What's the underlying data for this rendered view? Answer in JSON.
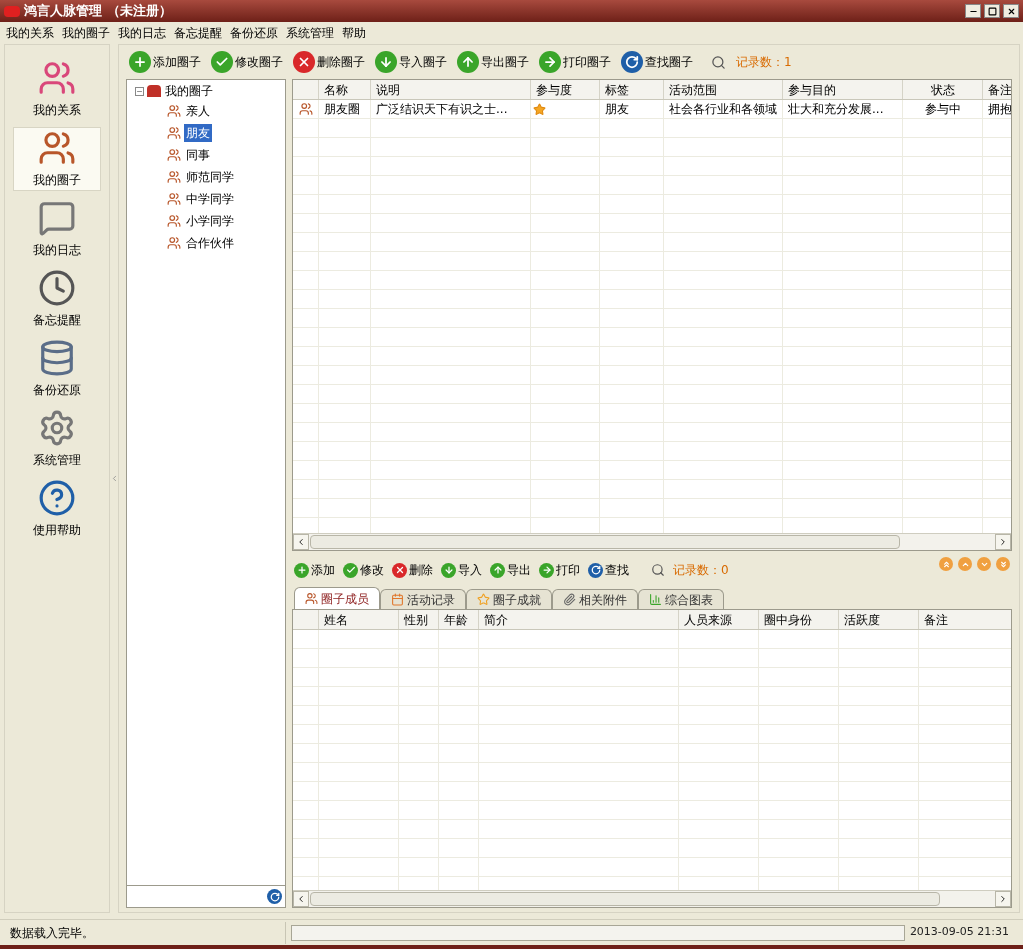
{
  "window": {
    "title": "鸿言人脉管理 （未注册）"
  },
  "menu": [
    "我的关系",
    "我的圈子",
    "我的日志",
    "备忘提醒",
    "备份还原",
    "系统管理",
    "帮助"
  ],
  "nav": [
    {
      "label": "我的关系",
      "kind": "people",
      "selected": false
    },
    {
      "label": "我的圈子",
      "kind": "group",
      "selected": true
    },
    {
      "label": "我的日志",
      "kind": "note",
      "selected": false
    },
    {
      "label": "备忘提醒",
      "kind": "clock",
      "selected": false
    },
    {
      "label": "备份还原",
      "kind": "database",
      "selected": false
    },
    {
      "label": "系统管理",
      "kind": "settings",
      "selected": false
    },
    {
      "label": "使用帮助",
      "kind": "help",
      "selected": false
    }
  ],
  "toolbar": {
    "buttons": [
      {
        "label": "添加圈子",
        "kind": "add"
      },
      {
        "label": "修改圈子",
        "kind": "edit"
      },
      {
        "label": "删除圈子",
        "kind": "delete"
      },
      {
        "label": "导入圈子",
        "kind": "import"
      },
      {
        "label": "导出圈子",
        "kind": "export"
      },
      {
        "label": "打印圈子",
        "kind": "print"
      },
      {
        "label": "查找圈子",
        "kind": "find"
      }
    ],
    "record_count": "记录数：1"
  },
  "tree": {
    "label": "我的圈子",
    "expanded": true,
    "children": [
      {
        "label": "亲人",
        "selected": false
      },
      {
        "label": "朋友",
        "selected": true
      },
      {
        "label": "同事",
        "selected": false
      },
      {
        "label": "师范同学",
        "selected": false
      },
      {
        "label": "中学同学",
        "selected": false
      },
      {
        "label": "小学同学",
        "selected": false
      },
      {
        "label": "合作伙伴",
        "selected": false
      }
    ]
  },
  "circles_table": {
    "columns": [
      "名称",
      "说明",
      "参与度",
      "标签",
      "活动范围",
      "参与目的",
      "状态",
      "备注"
    ],
    "rows": [
      {
        "name": "朋友圈",
        "description": "广泛结识天下有识之士...",
        "stars": 1,
        "tag": "朋友",
        "scope": "社会各行业和各领域",
        "purpose": "壮大和充分发展...",
        "status": "参与中",
        "note": "拥抱"
      }
    ]
  },
  "sub_toolbar": {
    "buttons": [
      {
        "label": "添加",
        "kind": "add"
      },
      {
        "label": "修改",
        "kind": "edit"
      },
      {
        "label": "删除",
        "kind": "delete"
      },
      {
        "label": "导入",
        "kind": "import"
      },
      {
        "label": "导出",
        "kind": "export"
      },
      {
        "label": "打印",
        "kind": "print"
      },
      {
        "label": "查找",
        "kind": "find"
      }
    ],
    "record_count": "记录数：0"
  },
  "tabs": [
    {
      "label": "圈子成员",
      "kind": "members",
      "selected": true
    },
    {
      "label": "活动记录",
      "kind": "activity",
      "selected": false
    },
    {
      "label": "圈子成就",
      "kind": "star",
      "selected": false
    },
    {
      "label": "相关附件",
      "kind": "attach",
      "selected": false
    },
    {
      "label": "综合图表",
      "kind": "chart",
      "selected": false
    }
  ],
  "members_table": {
    "columns": [
      "姓名",
      "性别",
      "年龄",
      "简介",
      "人员来源",
      "圈中身份",
      "活跃度",
      "备注"
    ]
  },
  "status_bar": {
    "message": "数据载入完毕。",
    "datetime": "2013-09-05 21:31"
  }
}
